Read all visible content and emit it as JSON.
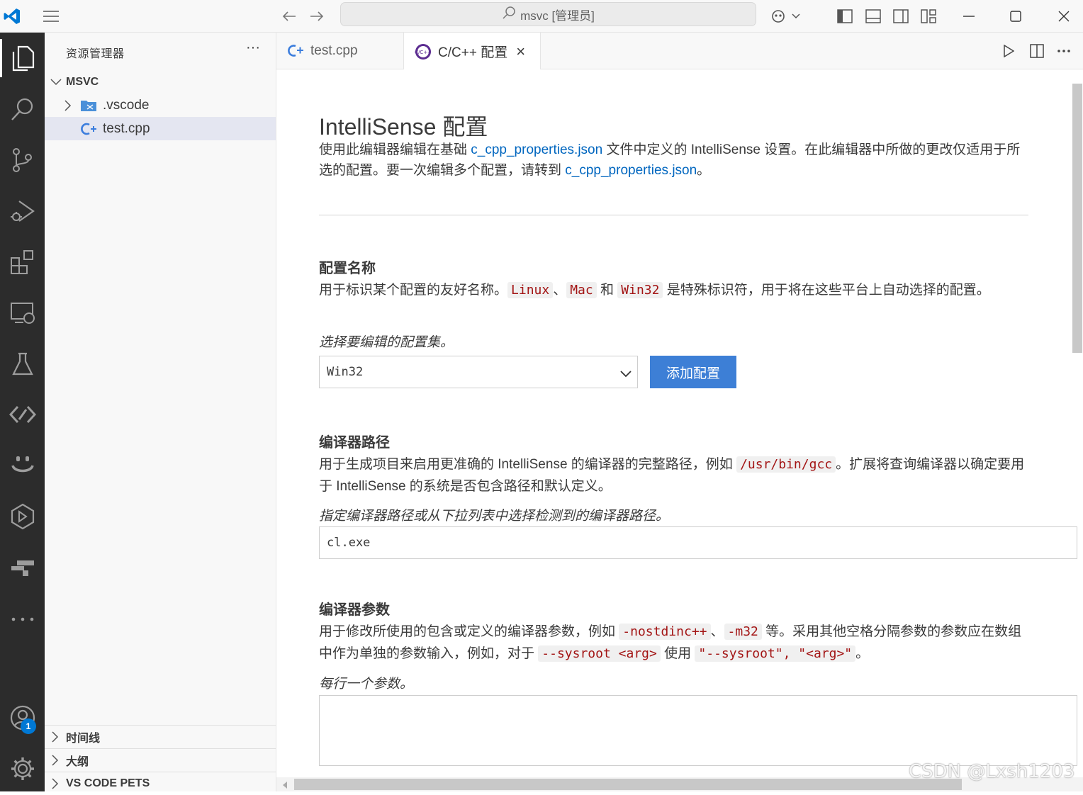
{
  "titlebar": {
    "search_text": "msvc [管理员]"
  },
  "sidebar": {
    "title": "资源管理器",
    "more": "···",
    "root": "MSVC",
    "items": [
      {
        "label": ".vscode"
      },
      {
        "label": "test.cpp"
      }
    ],
    "panes": [
      {
        "label": "时间线"
      },
      {
        "label": "大纲"
      },
      {
        "label": "VS CODE PETS"
      }
    ]
  },
  "tabs": [
    {
      "label": "test.cpp"
    },
    {
      "label": "C/C++ 配置",
      "close": "×"
    }
  ],
  "editor": {
    "title": "IntelliSense 配置",
    "intro_part1": "使用此编辑器编辑在基础 ",
    "intro_link1": "c_cpp_properties.json",
    "intro_part2": " 文件中定义的 IntelliSense 设置。在此编辑器中所做的更改仅适用于所选的配置。要一次编辑多个配置，请转到 ",
    "intro_link2": "c_cpp_properties.json",
    "intro_part3": "。",
    "config_name": {
      "title": "配置名称",
      "desc_a": "用于标识某个配置的友好名称。",
      "code1": "Linux",
      "sep1": "、",
      "code2": "Mac",
      "sep2": " 和 ",
      "code3": "Win32",
      "desc_b": " 是特殊标识符，用于将在这些平台上自动选择的配置。",
      "hint": "选择要编辑的配置集。",
      "selected": "Win32",
      "add_button": "添加配置"
    },
    "compiler_path": {
      "title": "编译器路径",
      "desc_a": "用于生成项目来启用更准确的 IntelliSense 的编译器的完整路径，例如 ",
      "code1": "/usr/bin/gcc",
      "desc_b": "。扩展将查询编译器以确定要用于 IntelliSense 的系统是否包含路径和默认定义。",
      "hint": "指定编译器路径或从下拉列表中选择检测到的编译器路径。",
      "value": "cl.exe"
    },
    "compiler_args": {
      "title": "编译器参数",
      "desc_a": "用于修改所使用的包含或定义的编译器参数，例如 ",
      "code1": "-nostdinc++",
      "sep1": "、",
      "code2": "-m32",
      "desc_b": " 等。采用其他空格分隔参数的参数应在数组中作为单独的参数输入，例如，对于 ",
      "code3": "--sysroot <arg>",
      "desc_c": " 使用 ",
      "code4": "\"--sysroot\", \"<arg>\"",
      "desc_d": "。",
      "hint": "每行一个参数。"
    }
  },
  "activity_badge": "1",
  "watermark": "CSDN @Lxsh1203",
  "colors": {
    "accent": "#3d7fd6",
    "link": "#0066bf",
    "code": "#a31515",
    "activitybar": "#2c2c2c"
  }
}
